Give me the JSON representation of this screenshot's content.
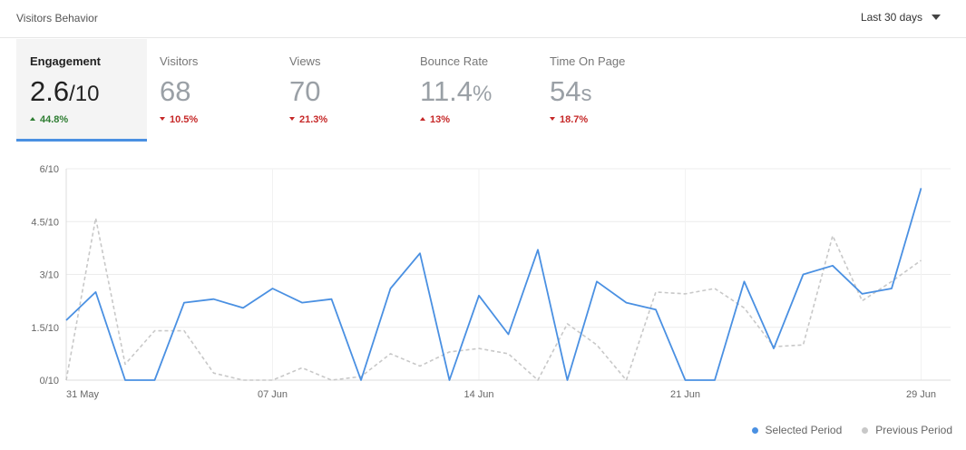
{
  "header": {
    "title": "Visitors Behavior",
    "range_label": "Last 30 days"
  },
  "metrics": [
    {
      "label": "Engagement",
      "value": "2.6",
      "unit": "/10",
      "change": "44.8%",
      "direction": "up",
      "tone": "good",
      "active": true
    },
    {
      "label": "Visitors",
      "value": "68",
      "unit": "",
      "change": "10.5%",
      "direction": "down",
      "tone": "bad",
      "active": false
    },
    {
      "label": "Views",
      "value": "70",
      "unit": "",
      "change": "21.3%",
      "direction": "down",
      "tone": "bad",
      "active": false
    },
    {
      "label": "Bounce Rate",
      "value": "11.4",
      "unit": "%",
      "change": "13%",
      "direction": "up",
      "tone": "bad",
      "active": false
    },
    {
      "label": "Time On Page",
      "value": "54",
      "unit": "s",
      "change": "18.7%",
      "direction": "down",
      "tone": "bad",
      "active": false
    }
  ],
  "colors": {
    "selected": "#4a90e2",
    "previous": "#c8c8c8",
    "grid": "#ececec"
  },
  "chart_data": {
    "type": "line",
    "x": [
      "31 May",
      "01 Jun",
      "02 Jun",
      "03 Jun",
      "04 Jun",
      "05 Jun",
      "06 Jun",
      "07 Jun",
      "08 Jun",
      "09 Jun",
      "10 Jun",
      "11 Jun",
      "12 Jun",
      "13 Jun",
      "14 Jun",
      "15 Jun",
      "16 Jun",
      "17 Jun",
      "18 Jun",
      "19 Jun",
      "20 Jun",
      "21 Jun",
      "22 Jun",
      "23 Jun",
      "24 Jun",
      "25 Jun",
      "26 Jun",
      "27 Jun",
      "28 Jun",
      "29 Jun",
      "30 Jun"
    ],
    "x_tick_labels": [
      "31 May",
      "07 Jun",
      "14 Jun",
      "21 Jun",
      "29 Jun"
    ],
    "x_tick_indices": [
      0,
      7,
      14,
      21,
      29
    ],
    "y_tick_labels": [
      "0/10",
      "1.5/10",
      "3/10",
      "4.5/10",
      "6/10"
    ],
    "y_tick_values": [
      0,
      1.5,
      3,
      4.5,
      6
    ],
    "ylim": [
      0,
      6
    ],
    "grid": true,
    "legend_position": "bottom-right",
    "series": [
      {
        "name": "Selected Period",
        "style": "solid",
        "values": [
          1.7,
          2.5,
          0,
          0,
          2.2,
          2.3,
          2.05,
          2.6,
          2.2,
          2.3,
          0,
          2.6,
          3.6,
          0,
          2.4,
          1.3,
          3.7,
          0,
          2.8,
          2.2,
          2.0,
          0,
          0,
          2.8,
          0.9,
          3.0,
          3.25,
          2.45,
          2.6,
          5.45
        ]
      },
      {
        "name": "Previous Period",
        "style": "dashed",
        "values": [
          0,
          4.6,
          0.45,
          1.4,
          1.4,
          0.2,
          0,
          0,
          0.35,
          0,
          0.1,
          0.75,
          0.4,
          0.8,
          0.9,
          0.75,
          0,
          1.6,
          1.0,
          0,
          2.5,
          2.45,
          2.6,
          2.05,
          0.95,
          1.0,
          4.1,
          2.25,
          2.8,
          3.4
        ]
      }
    ]
  }
}
